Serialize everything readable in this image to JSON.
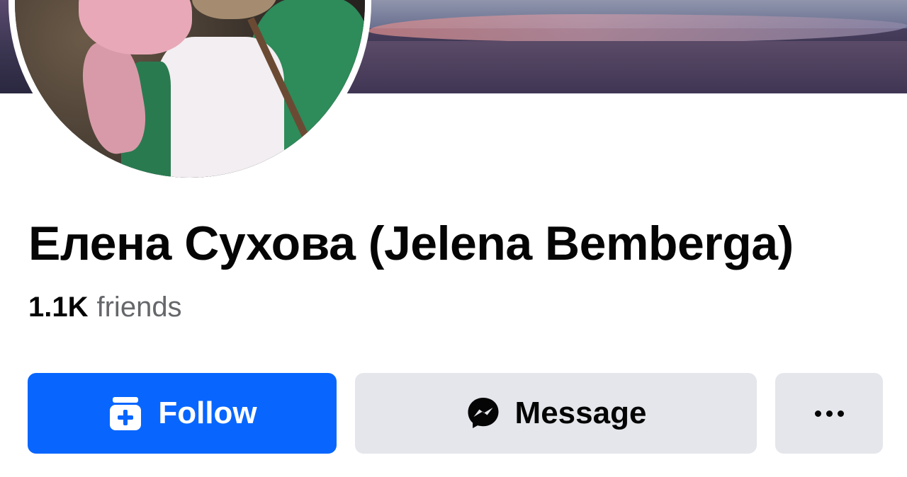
{
  "profile": {
    "name": "Елена Сухова (Jelena Bemberga)",
    "friends_count": "1.1K",
    "friends_label": "friends"
  },
  "actions": {
    "follow_label": "Follow",
    "message_label": "Message"
  },
  "icons": {
    "follow": "follow-icon",
    "message": "messenger-icon",
    "more": "more-dots-icon"
  },
  "colors": {
    "primary": "#0866ff",
    "secondary_button": "#e4e6eb",
    "text_primary": "#050505",
    "text_secondary": "#65676b"
  }
}
